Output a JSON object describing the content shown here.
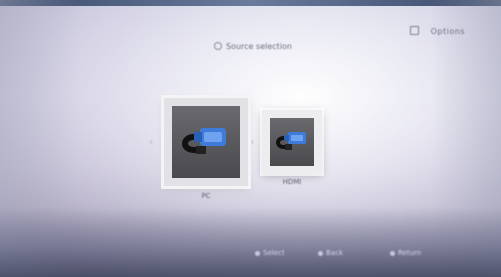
{
  "screen": {
    "title": "Source selection",
    "corner_label": "Options"
  },
  "sources": [
    {
      "label": "PC",
      "icon": "vga-cable-icon",
      "selected": true
    },
    {
      "label": "HDMI",
      "icon": "cable-icon",
      "selected": false
    }
  ],
  "footer": {
    "buttons": [
      "Select",
      "Back",
      "Return"
    ]
  },
  "colors": {
    "accent": "#3f7bd9",
    "card_bg": "#ededef"
  }
}
